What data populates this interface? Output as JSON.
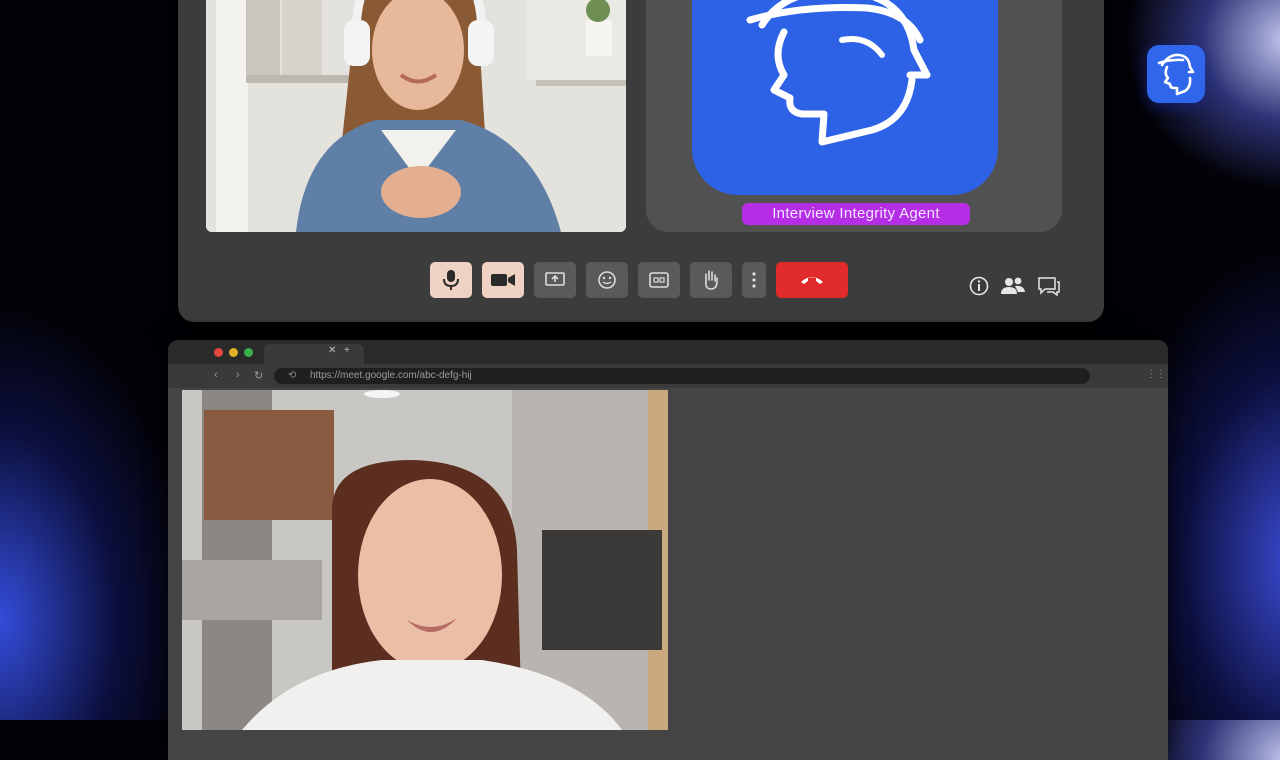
{
  "meeting": {
    "agent_label": "Interview Integrity Agent",
    "controls": [
      {
        "name": "microphone",
        "state": "on"
      },
      {
        "name": "camera",
        "state": "on"
      },
      {
        "name": "present-screen",
        "state": "off"
      },
      {
        "name": "emoji-reactions",
        "state": "off"
      },
      {
        "name": "captions",
        "state": "off"
      },
      {
        "name": "raise-hand",
        "state": "off"
      },
      {
        "name": "more-options",
        "state": "off"
      },
      {
        "name": "end-call",
        "state": "danger"
      }
    ],
    "side_icons": [
      "info-icon",
      "people-icon",
      "chat-icon"
    ]
  },
  "browser": {
    "url": "https://meet.google.com/abc-defg-hij"
  },
  "colors": {
    "brand_blue": "#2d62e6",
    "agent_label_bg": "#b52ee6",
    "end_call_red": "#e12a2a",
    "active_control_bg": "#f0d2c4"
  }
}
